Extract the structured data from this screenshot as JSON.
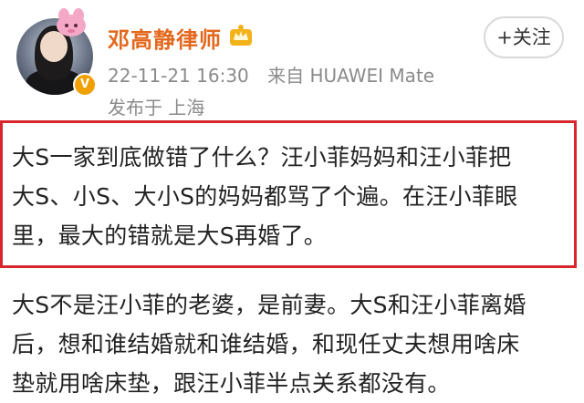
{
  "post": {
    "author_name": "邓高静律师",
    "verified_badge": "V",
    "vip_icon": "vip-crown-icon",
    "follow_label": "+关注",
    "timestamp": "22-11-21 16:30",
    "source": "来自 HUAWEI Mate",
    "location": "发布于 上海",
    "highlighted_lines": [
      "大S一家到底做错了什么？汪小菲妈妈和汪小菲把",
      "大S、小S、大小S的妈妈都骂了个遍。在汪小菲眼",
      "里，最大的错就是大S再婚了。"
    ],
    "body_lines": [
      "大S不是汪小菲的老婆，是前妻。大S和汪小菲离婚",
      "后，想和谁结婚就和谁结婚，和现任丈夫想用啥床",
      "垫就用啥床垫，跟汪小菲半点关系都没有。"
    ]
  },
  "colors": {
    "author_name": "#e3671c",
    "highlight_border": "#d8262c",
    "meta_text": "#8a8a8a",
    "body_text": "#222222"
  }
}
